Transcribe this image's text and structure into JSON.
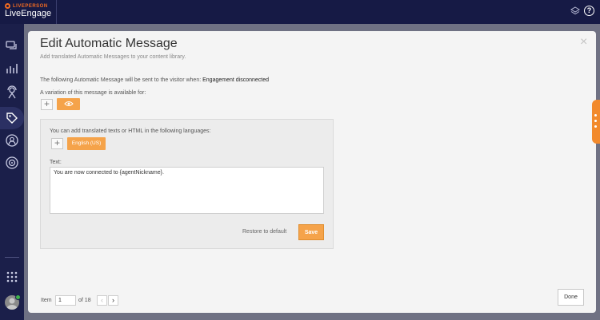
{
  "app": {
    "brand_small": "LIVEPERSON",
    "brand_name": "LiveEngage"
  },
  "topbar": {
    "icons": [
      "layers-icon",
      "help-icon"
    ],
    "help_glyph": "?"
  },
  "sidebar": {
    "items": [
      {
        "name": "messaging-icon"
      },
      {
        "name": "analytics-icon"
      },
      {
        "name": "agent-icon"
      },
      {
        "name": "tags-icon",
        "active": true
      },
      {
        "name": "user-icon"
      },
      {
        "name": "campaign-icon"
      }
    ],
    "apps_icon": "grid-icon"
  },
  "modal": {
    "title": "Edit Automatic Message",
    "subtitle": "Add translated Automatic Messages to your content library.",
    "close_glyph": "×",
    "sent_prefix": "The following Automatic Message will be sent to the visitor when:",
    "sent_event": "Engagement disconnected",
    "variation_label": "A variation of this message is available for:",
    "add_variation_glyph": "+",
    "variation_pill": "👁",
    "panel": {
      "hint": "You can add translated texts or HTML in the following languages:",
      "add_language_glyph": "+",
      "language": "English (US)",
      "text_label": "Text:",
      "text_value": "You are now connected to {agentNickname}.",
      "restore_label": "Restore to default",
      "save_label": "Save"
    },
    "footer": {
      "item_label": "Item",
      "item_value": "1",
      "of_label": "of",
      "total": "18",
      "prev_glyph": "‹",
      "next_glyph": "›",
      "done_label": "Done"
    }
  },
  "colors": {
    "accent_orange": "#f5a34a",
    "nav_dark": "#1b1f4a",
    "status_online": "#3fb24a"
  }
}
